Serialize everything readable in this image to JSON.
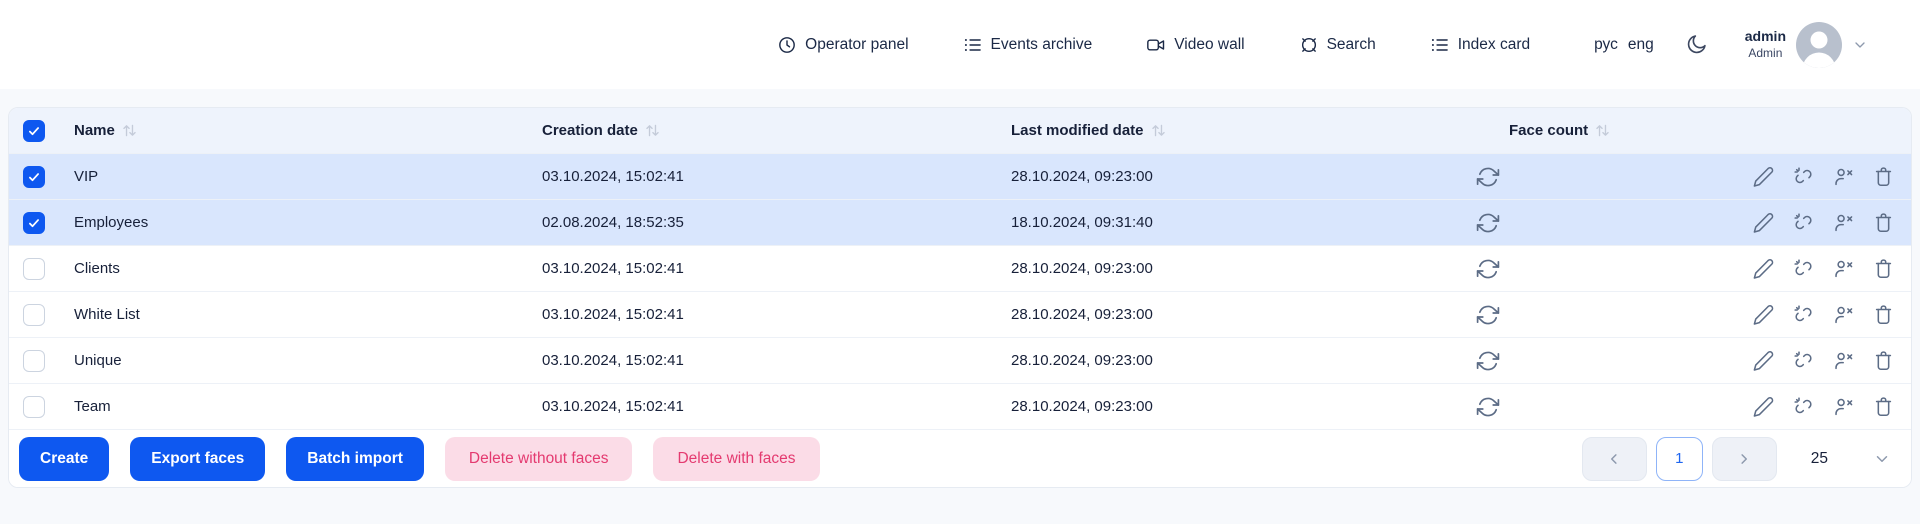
{
  "nav": {
    "items": [
      {
        "label": "Operator panel",
        "icon": "clock-icon"
      },
      {
        "label": "Events archive",
        "icon": "list-details-icon"
      },
      {
        "label": "Video wall",
        "icon": "video-camera-icon"
      },
      {
        "label": "Search",
        "icon": "crosshair-icon"
      },
      {
        "label": "Index card",
        "icon": "list-details-icon"
      }
    ],
    "languages": [
      {
        "label": "рус"
      },
      {
        "label": "eng"
      }
    ],
    "theme_icon": "moon-icon",
    "user": {
      "name": "admin",
      "role": "Admin"
    }
  },
  "table": {
    "select_all_checked": true,
    "columns": [
      {
        "label": "Name",
        "sortable": true
      },
      {
        "label": "Creation date",
        "sortable": true
      },
      {
        "label": "Last modified date",
        "sortable": true
      },
      {
        "label": "Face count",
        "sortable": true
      }
    ],
    "row_icons": {
      "face_count": "refresh-icon",
      "actions": [
        "edit-pencil-icon",
        "unlink-icon",
        "remove-user-icon",
        "trash-icon"
      ]
    },
    "rows": [
      {
        "name": "VIP",
        "creation_date": "03.10.2024, 15:02:41",
        "last_modified": "28.10.2024, 09:23:00",
        "selected": true
      },
      {
        "name": "Employees",
        "creation_date": "02.08.2024, 18:52:35",
        "last_modified": "18.10.2024, 09:31:40",
        "selected": true
      },
      {
        "name": "Clients",
        "creation_date": "03.10.2024, 15:02:41",
        "last_modified": "28.10.2024, 09:23:00",
        "selected": false
      },
      {
        "name": "White List",
        "creation_date": "03.10.2024, 15:02:41",
        "last_modified": "28.10.2024, 09:23:00",
        "selected": false
      },
      {
        "name": "Unique",
        "creation_date": "03.10.2024, 15:02:41",
        "last_modified": "28.10.2024, 09:23:00",
        "selected": false
      },
      {
        "name": "Team",
        "creation_date": "03.10.2024, 15:02:41",
        "last_modified": "28.10.2024, 09:23:00",
        "selected": false
      }
    ]
  },
  "footer": {
    "primary_buttons": [
      {
        "label": "Create"
      },
      {
        "label": "Export faces"
      },
      {
        "label": "Batch import"
      }
    ],
    "danger_buttons": [
      {
        "label": "Delete without faces"
      },
      {
        "label": "Delete with faces"
      }
    ],
    "pagination": {
      "current_page": "1",
      "page_size": "25"
    }
  },
  "colors": {
    "primary_blue": "#0e58f0",
    "selected_row_bg": "#d9e6fd",
    "table_header_bg": "#eef3fc",
    "danger_bg": "#fbdce7",
    "danger_text": "#e43a70",
    "page_bg": "#f7f9fc"
  }
}
